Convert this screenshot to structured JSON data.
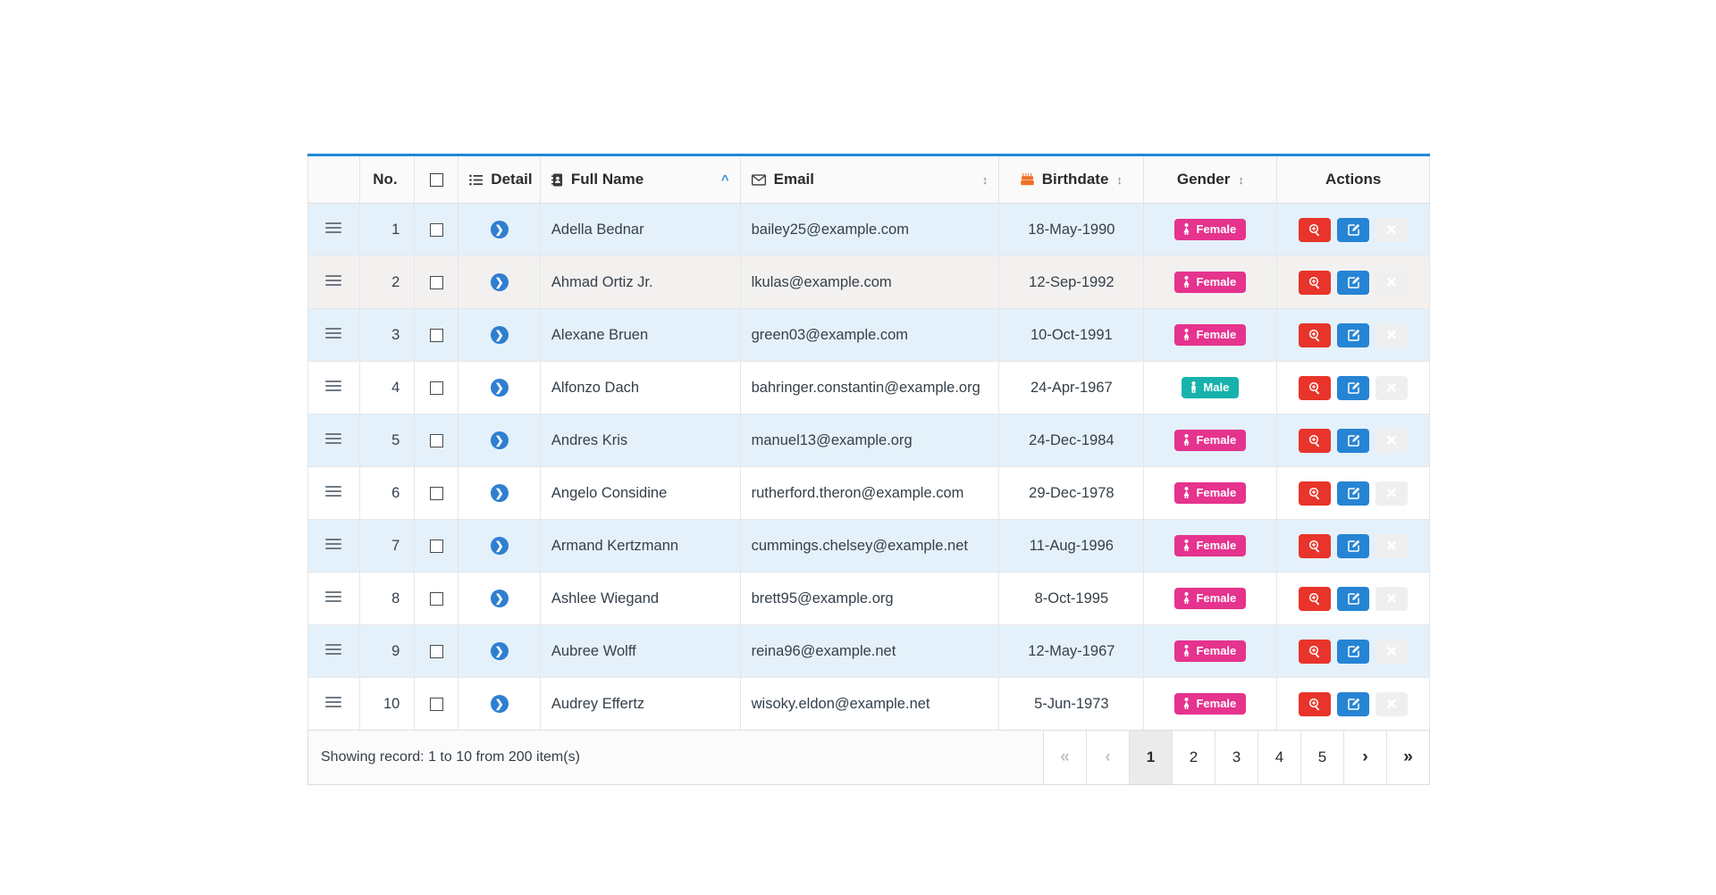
{
  "table": {
    "columns": [
      {
        "key": "handle",
        "label": "",
        "icon": "",
        "sort": "none"
      },
      {
        "key": "no",
        "label": "No.",
        "icon": "",
        "sort": "none"
      },
      {
        "key": "check",
        "label": "",
        "icon": "checkbox-icon",
        "sort": "none"
      },
      {
        "key": "detail",
        "label": "Detail",
        "icon": "list-icon",
        "sort": "none"
      },
      {
        "key": "name",
        "label": "Full Name",
        "icon": "address-book-icon",
        "sort": "asc"
      },
      {
        "key": "email",
        "label": "Email",
        "icon": "envelope-icon",
        "sort": "both"
      },
      {
        "key": "birth",
        "label": "Birthdate",
        "icon": "birthday-cake-icon",
        "sort": "both"
      },
      {
        "key": "gender",
        "label": "Gender",
        "icon": "",
        "sort": "both"
      },
      {
        "key": "actions",
        "label": "Actions",
        "icon": "",
        "sort": "none"
      }
    ],
    "rows": [
      {
        "no": "1",
        "name": "Adella Bednar",
        "email": "bailey25@example.com",
        "birthdate": "18-May-1990",
        "gender": "Female",
        "stripe": "odd"
      },
      {
        "no": "2",
        "name": "Ahmad Ortiz Jr.",
        "email": "lkulas@example.com",
        "birthdate": "12-Sep-1992",
        "gender": "Female",
        "stripe": "hover"
      },
      {
        "no": "3",
        "name": "Alexane Bruen",
        "email": "green03@example.com",
        "birthdate": "10-Oct-1991",
        "gender": "Female",
        "stripe": "odd"
      },
      {
        "no": "4",
        "name": "Alfonzo Dach",
        "email": "bahringer.constantin@example.org",
        "birthdate": "24-Apr-1967",
        "gender": "Male",
        "stripe": "even"
      },
      {
        "no": "5",
        "name": "Andres Kris",
        "email": "manuel13@example.org",
        "birthdate": "24-Dec-1984",
        "gender": "Female",
        "stripe": "odd"
      },
      {
        "no": "6",
        "name": "Angelo Considine",
        "email": "rutherford.theron@example.com",
        "birthdate": "29-Dec-1978",
        "gender": "Female",
        "stripe": "even"
      },
      {
        "no": "7",
        "name": "Armand Kertzmann",
        "email": "cummings.chelsey@example.net",
        "birthdate": "11-Aug-1996",
        "gender": "Female",
        "stripe": "odd"
      },
      {
        "no": "8",
        "name": "Ashlee Wiegand",
        "email": "brett95@example.org",
        "birthdate": "8-Oct-1995",
        "gender": "Female",
        "stripe": "even"
      },
      {
        "no": "9",
        "name": "Aubree Wolff",
        "email": "reina96@example.net",
        "birthdate": "12-May-1967",
        "gender": "Female",
        "stripe": "odd"
      },
      {
        "no": "10",
        "name": "Audrey Effertz",
        "email": "wisoky.eldon@example.net",
        "birthdate": "5-Jun-1973",
        "gender": "Female",
        "stripe": "even"
      }
    ],
    "row_actions": [
      {
        "key": "view",
        "icon": "search-plus-icon",
        "color": "#e8342a"
      },
      {
        "key": "edit",
        "icon": "pencil-square-icon",
        "color": "#2684d4"
      },
      {
        "key": "delete",
        "icon": "times-icon",
        "color": "#2fbf5c"
      }
    ]
  },
  "gender_badges": {
    "Female": {
      "label": "Female",
      "color": "#e5338e"
    },
    "Male": {
      "label": "Male",
      "color": "#17b2ab"
    }
  },
  "footer": {
    "record_info": "Showing record: 1 to 10 from 200 item(s)",
    "pagination": [
      {
        "label": "«",
        "name": "first-page",
        "state": "disabled"
      },
      {
        "label": "‹",
        "name": "prev-page",
        "state": "disabled"
      },
      {
        "label": "1",
        "name": "page-1",
        "state": "active"
      },
      {
        "label": "2",
        "name": "page-2",
        "state": "normal"
      },
      {
        "label": "3",
        "name": "page-3",
        "state": "normal"
      },
      {
        "label": "4",
        "name": "page-4",
        "state": "normal"
      },
      {
        "label": "5",
        "name": "page-5",
        "state": "normal"
      },
      {
        "label": "›",
        "name": "next-page",
        "state": "normal"
      },
      {
        "label": "»",
        "name": "last-page",
        "state": "normal"
      }
    ]
  },
  "theme": {
    "accent_top_border": "#2189d6",
    "row_odd": "#e4f1fb",
    "row_even": "#ffffff",
    "row_hover": "#f3f1f0",
    "header_bg": "#fafafa",
    "detail_button": "#2f7fd1",
    "cake_icon": "#f07124"
  }
}
